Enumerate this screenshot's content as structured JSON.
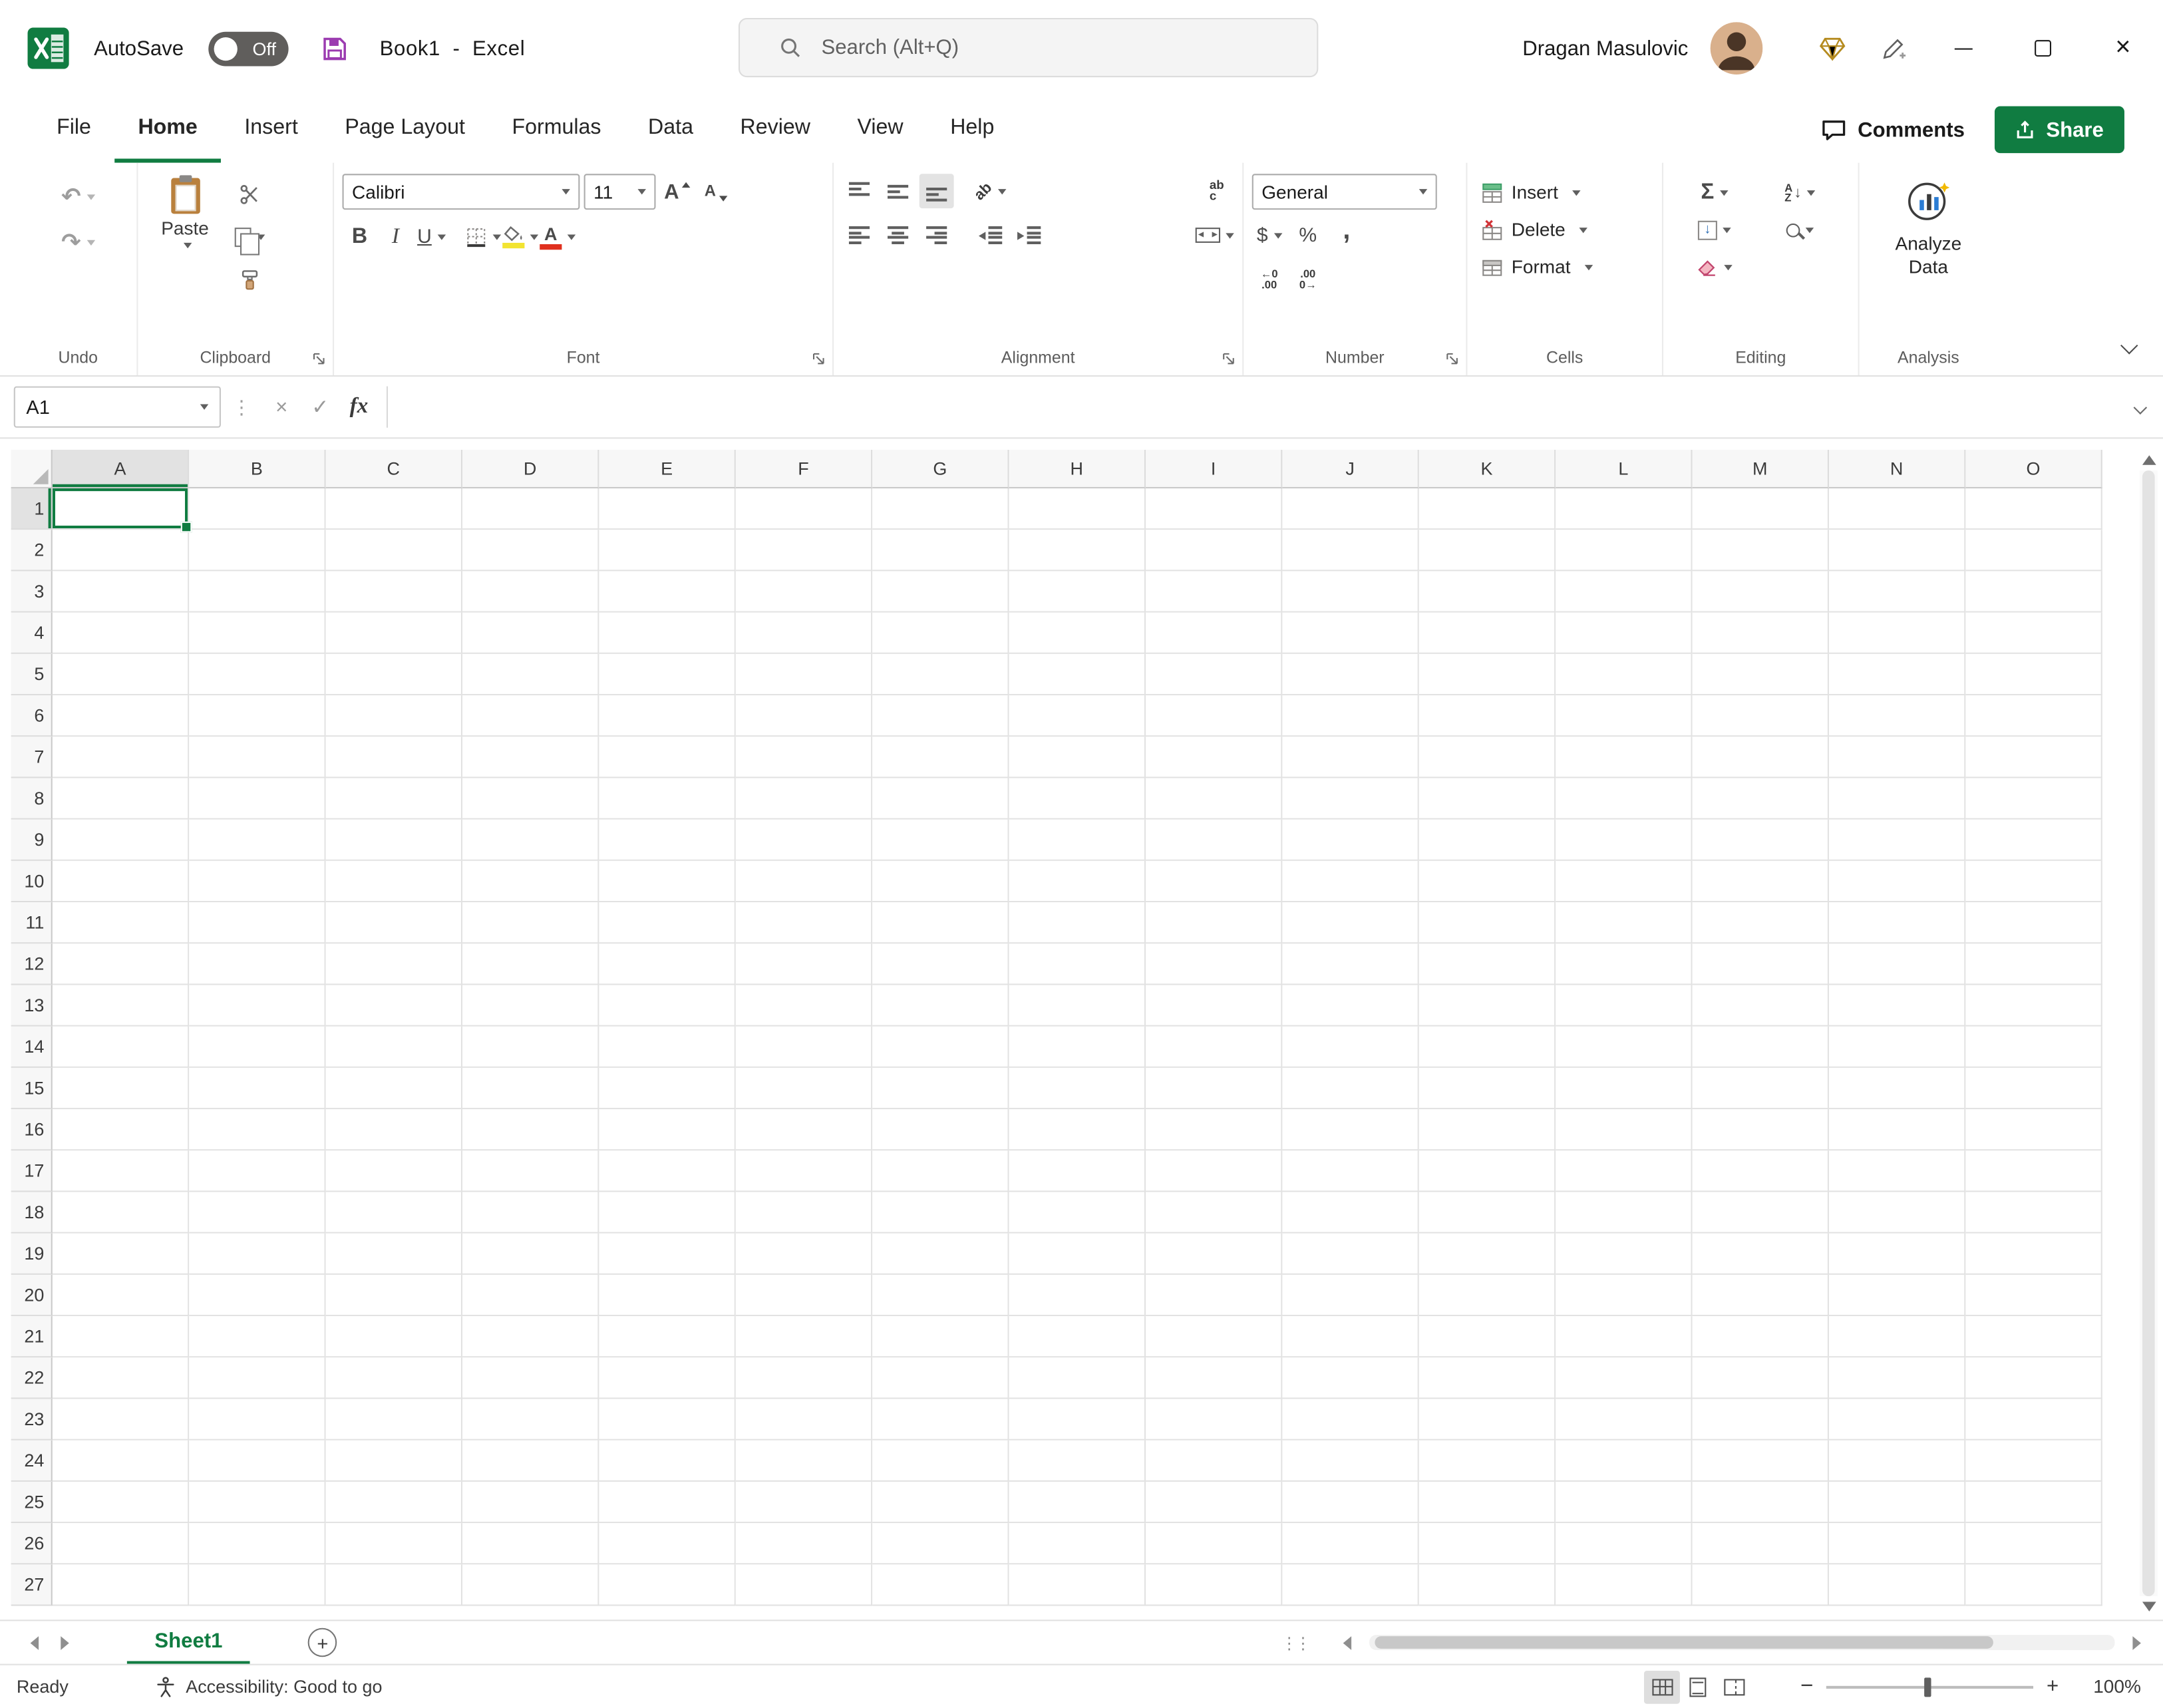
{
  "colors": {
    "accent_green": "#107C41",
    "fill_color_swatch": "#F2E431",
    "font_color_swatch": "#E0301E"
  },
  "titlebar": {
    "autosave_label": "AutoSave",
    "autosave_state": "Off",
    "document_title": "Book1  -  Excel",
    "search_placeholder": "Search (Alt+Q)",
    "user_name": "Dragan Masulovic"
  },
  "ribbon_tabs": [
    "File",
    "Home",
    "Insert",
    "Page Layout",
    "Formulas",
    "Data",
    "Review",
    "View",
    "Help"
  ],
  "active_tab": "Home",
  "actions": {
    "comments": "Comments",
    "share": "Share"
  },
  "ribbon": {
    "undo_group": "Undo",
    "clipboard_group": "Clipboard",
    "paste": "Paste",
    "font_group": "Font",
    "font_name": "Calibri",
    "font_size": "11",
    "alignment_group": "Alignment",
    "number_group": "Number",
    "number_format": "General",
    "cells_group": "Cells",
    "insert": "Insert",
    "delete": "Delete",
    "format": "Format",
    "editing_group": "Editing",
    "analysis_group": "Analysis",
    "analyze_data": "Analyze Data"
  },
  "formula_bar": {
    "name_box": "A1",
    "value": ""
  },
  "grid": {
    "columns": [
      "A",
      "B",
      "C",
      "D",
      "E",
      "F",
      "G",
      "H",
      "I",
      "J",
      "K",
      "L",
      "M",
      "N",
      "O"
    ],
    "rows": [
      "1",
      "2",
      "3",
      "4",
      "5",
      "6",
      "7",
      "8",
      "9",
      "10",
      "11",
      "12",
      "13",
      "14",
      "15",
      "16",
      "17",
      "18",
      "19",
      "20",
      "21",
      "22",
      "23",
      "24",
      "25",
      "26",
      "27"
    ],
    "selected_cell": "A1",
    "selected_column": "A",
    "selected_row": "1"
  },
  "sheet_bar": {
    "active_sheet": "Sheet1"
  },
  "status_bar": {
    "mode": "Ready",
    "accessibility": "Accessibility: Good to go",
    "zoom_level": "100%"
  },
  "glyphs": {
    "undo": "↶",
    "redo": "↷",
    "bold": "B",
    "italic": "I",
    "underline": "U",
    "grow_font": "A",
    "shrink_font": "A",
    "font_color": "A",
    "orientation": "ab",
    "wrap_line1": "ab",
    "wrap_line2": "c",
    "dollar": "$",
    "percent": "%",
    "comma": ",",
    "inc_dec_top": "←0",
    "inc_dec_bottom": ".00",
    "dec_dec_top": ".00",
    "dec_dec_bottom": "0→",
    "autosum": "Σ",
    "sort_a": "A",
    "sort_z": "Z",
    "down_arrow": "↓",
    "fx": "fx",
    "cancel": "×",
    "check": "✓",
    "vdots": "⋮",
    "grip": "⋮⋮",
    "plus": "+",
    "minus": "−",
    "close": "×"
  }
}
